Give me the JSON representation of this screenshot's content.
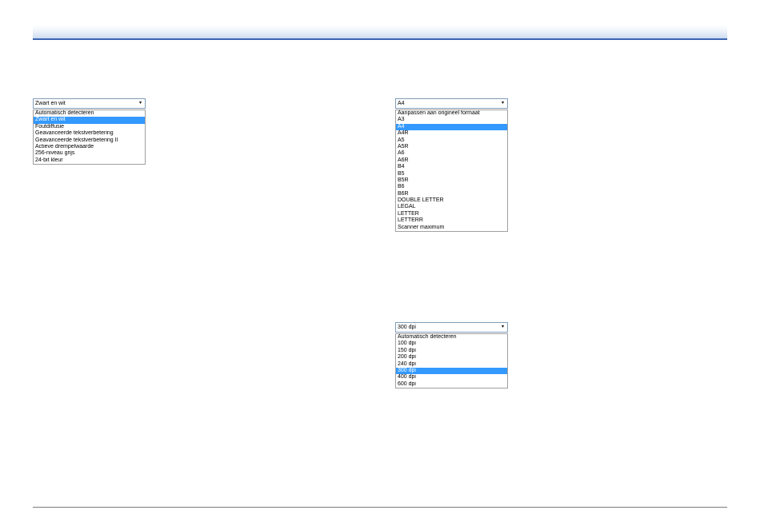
{
  "dropdowns": {
    "color_mode": {
      "value": "Zwart en wit",
      "options": [
        "Automatisch detecteren",
        "Zwart en wit",
        "Foutdiffusie",
        "Geavanceerde tekstverbetering",
        "Geavanceerde tekstverbetering II",
        "Actieve drempelwaarde",
        "256-niveau grijs",
        "24-bit kleur"
      ],
      "selected_index": 1
    },
    "page_size": {
      "value": "A4",
      "options": [
        "Aanpassen aan origineel formaat",
        "A3",
        "A4",
        "A4R",
        "A5",
        "A5R",
        "A6",
        "A6R",
        "B4",
        "B5",
        "B5R",
        "B6",
        "B6R",
        "DOUBLE LETTER",
        "LEGAL",
        "LETTER",
        "LETTERR",
        "Scanner maximum"
      ],
      "selected_index": 2
    },
    "resolution": {
      "value": "300 dpi",
      "options": [
        "Automatisch detecteren",
        "100 dpi",
        "150 dpi",
        "200 dpi",
        "240 dpi",
        "300 dpi",
        "400 dpi",
        "600 dpi"
      ],
      "selected_index": 5
    }
  },
  "icons": {
    "dropdown_arrow": "▾"
  },
  "colors": {
    "selection": "#3399ff",
    "header_rule": "#3a64b4"
  }
}
